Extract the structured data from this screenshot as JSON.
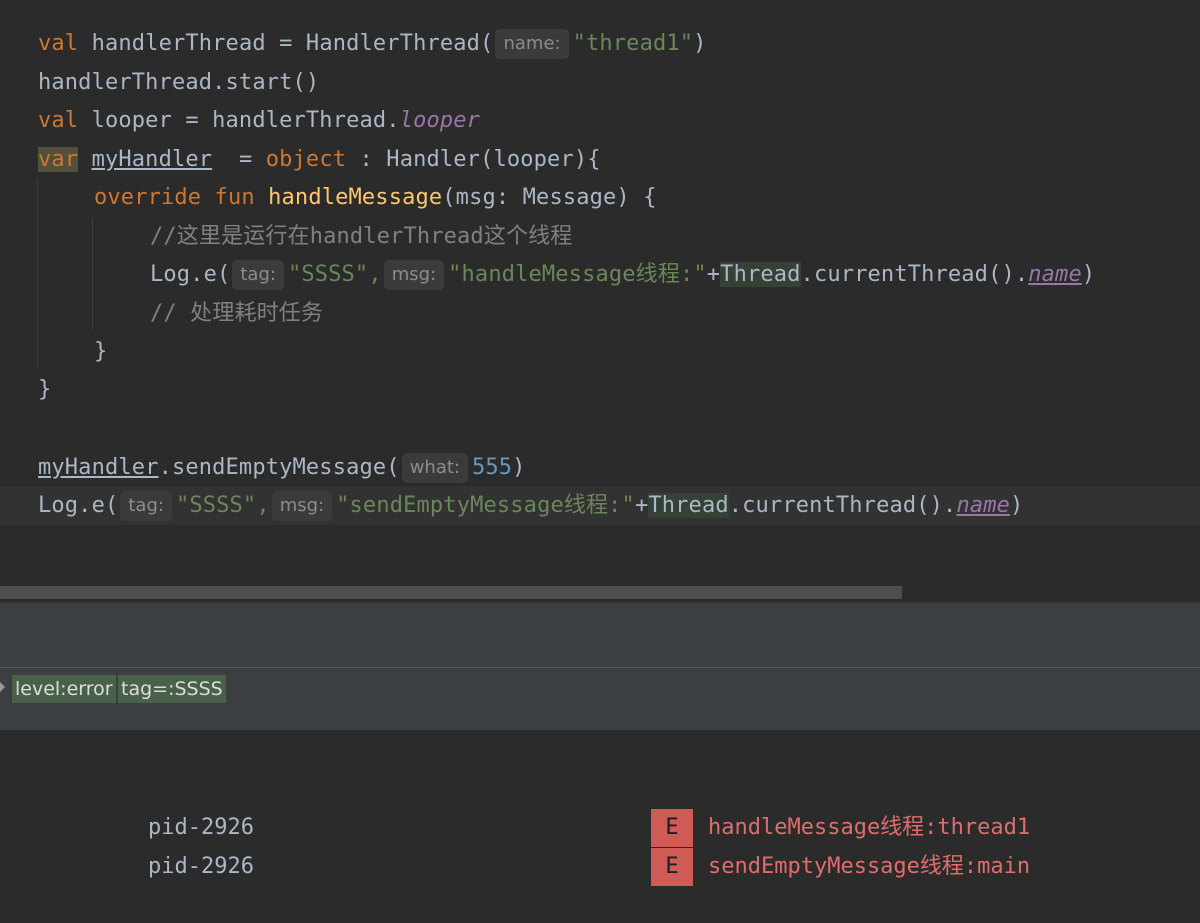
{
  "editor": {
    "line1": {
      "kw": "val",
      "ident": "handlerThread",
      "op": " = ",
      "call": "HandlerThread(",
      "hint": "name:",
      "str": "\"thread1\"",
      "close": ")"
    },
    "line2": {
      "text": "handlerThread.start()"
    },
    "line3": {
      "kw": "val",
      "ident": " looper = handlerThread.",
      "prop": "looper"
    },
    "line4": {
      "kw": "var",
      "ident": "myHandler",
      "op": "  = ",
      "kw2": "object",
      "rest": " : Handler(looper){"
    },
    "line5": {
      "kw": "override fun ",
      "fn": "handleMessage",
      "rest": "(msg: Message) {"
    },
    "line6": {
      "comment": "//这里是运行在handlerThread这个线程"
    },
    "line7": {
      "call": "Log.e(",
      "hint_tag": "tag:",
      "tag": "\"SSSS\",",
      "hint_msg": "msg:",
      "msg": "\"handleMessage线程:\"",
      "plus": "+",
      "cls": "Thread",
      "mid": ".currentThread().",
      "prop": "name",
      "close": ")"
    },
    "line8": {
      "comment": "// 处理耗时任务"
    },
    "line9": {
      "text": "}"
    },
    "line10": {
      "text": "}"
    },
    "line11": {
      "ident": "myHandler",
      "call": ".sendEmptyMessage(",
      "hint": "what:",
      "num": "555",
      "close": ")"
    },
    "line12": {
      "call": "Log.e(",
      "hint_tag": "tag:",
      "tag": "\"SSSS\",",
      "hint_msg": "msg:",
      "msg": "\"sendEmptyMessage线程:\"",
      "plus": "+",
      "cls": "Thread",
      "mid": ".currentThread().",
      "prop": "name",
      "close": ")"
    }
  },
  "logcat": {
    "filters": [
      "level:error",
      "tag=:SSSS"
    ],
    "rows": [
      {
        "pid": "pid-2926",
        "level": "E",
        "message": "handleMessage线程:thread1"
      },
      {
        "pid": "pid-2926",
        "level": "E",
        "message": "sendEmptyMessage线程:main"
      }
    ]
  },
  "colors": {
    "keyword": "#cc7832",
    "string": "#6a8759",
    "function": "#ffc66d",
    "error": "#cf5b56"
  }
}
